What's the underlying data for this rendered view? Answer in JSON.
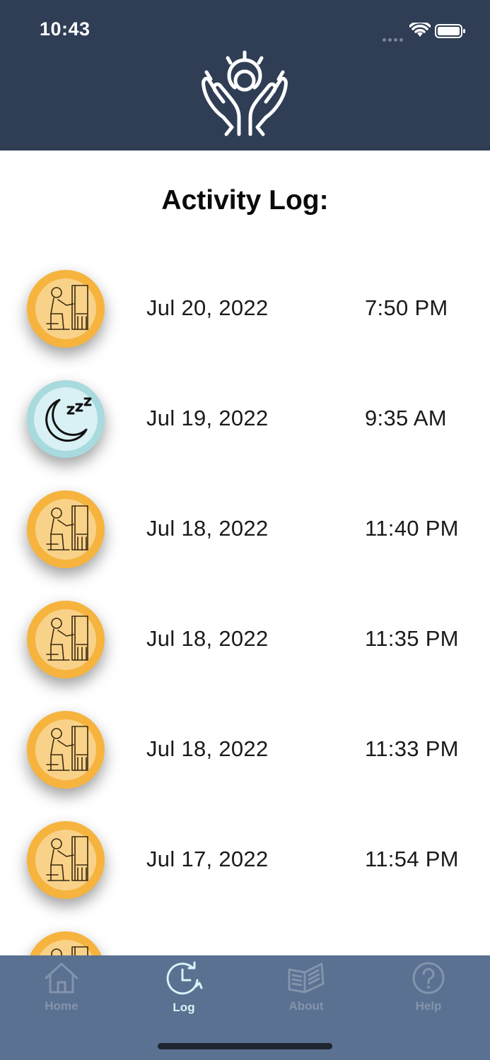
{
  "status_bar": {
    "time": "10:43"
  },
  "header": {
    "logo_icon": "hands-lightbulb-logo-icon",
    "background": "#2f3d55"
  },
  "page": {
    "title": "Activity Log:"
  },
  "log": [
    {
      "type": "work",
      "icon": "person-at-desk-icon",
      "date": "Jul 20, 2022",
      "time": "7:50 PM"
    },
    {
      "type": "sleep",
      "icon": "moon-sleep-icon",
      "date": "Jul 19, 2022",
      "time": "9:35 AM"
    },
    {
      "type": "work",
      "icon": "person-at-desk-icon",
      "date": "Jul 18, 2022",
      "time": "11:40 PM"
    },
    {
      "type": "work",
      "icon": "person-at-desk-icon",
      "date": "Jul 18, 2022",
      "time": "11:35 PM"
    },
    {
      "type": "work",
      "icon": "person-at-desk-icon",
      "date": "Jul 18, 2022",
      "time": "11:33 PM"
    },
    {
      "type": "work",
      "icon": "person-at-desk-icon",
      "date": "Jul 17, 2022",
      "time": "11:54 PM"
    },
    {
      "type": "work",
      "icon": "person-at-desk-icon",
      "date": "",
      "time": ""
    }
  ],
  "tabs": [
    {
      "label": "Home",
      "icon": "home-icon",
      "active": false
    },
    {
      "label": "Log",
      "icon": "clock-history-icon",
      "active": true
    },
    {
      "label": "About",
      "icon": "book-icon",
      "active": false
    },
    {
      "label": "Help",
      "icon": "question-circle-icon",
      "active": false
    }
  ],
  "colors": {
    "tabbar": "#5a7192",
    "active_tab": "#d9f3f6",
    "inactive_tab": "#8494ab",
    "work_badge": "#f6b43e",
    "sleep_badge": "#a8dade"
  }
}
